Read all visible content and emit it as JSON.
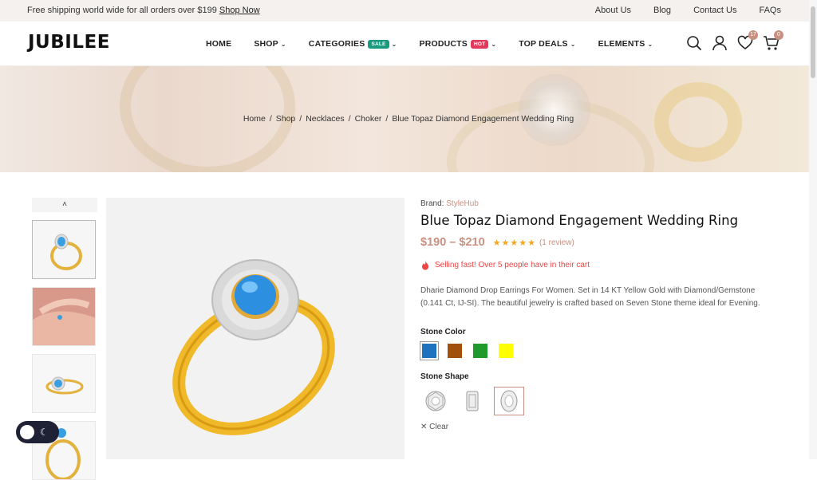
{
  "topbar": {
    "promo_text": "Free shipping world wide for all orders over $199",
    "promo_link": "Shop Now",
    "links": [
      "About Us",
      "Blog",
      "Contact Us",
      "FAQs"
    ]
  },
  "header": {
    "logo": "JUBILEE",
    "nav": [
      {
        "label": "HOME",
        "chevron": false,
        "badge": ""
      },
      {
        "label": "SHOP",
        "chevron": true,
        "badge": ""
      },
      {
        "label": "CATEGORIES",
        "chevron": true,
        "badge": "SALE"
      },
      {
        "label": "PRODUCTS",
        "chevron": true,
        "badge": "HOT"
      },
      {
        "label": "TOP DEALS",
        "chevron": true,
        "badge": ""
      },
      {
        "label": "ELEMENTS",
        "chevron": true,
        "badge": ""
      }
    ],
    "wishlist_count": "17",
    "cart_count": "0",
    "icons": [
      "search-icon",
      "user-icon",
      "heart-icon",
      "cart-icon"
    ]
  },
  "breadcrumb": [
    "Home",
    "Shop",
    "Necklaces",
    "Choker",
    "Blue Topaz Diamond Engagement Wedding Ring"
  ],
  "product": {
    "brand_label": "Brand:",
    "brand_name": "StyleHub",
    "title": "Blue Topaz Diamond Engagement Wedding Ring",
    "price": "$190 – $210",
    "rating": 4.5,
    "stars": "★★★★★",
    "review_text": "(1 review)",
    "selling_fast": "Selling fast! Over 5 people have in their cart",
    "description": "Dharie Diamond Drop Earrings For Women. Set in 14 KT Yellow Gold with Diamond/Gemstone (0.141 Ct, IJ-SI). The beautiful jewelry is crafted based on Seven Stone theme ideal for Evening.",
    "stone_color_label": "Stone Color",
    "stone_colors": [
      "#1e73be",
      "#a0500a",
      "#1f9a2c",
      "#ffff00"
    ],
    "selected_color_index": 0,
    "stone_shape_label": "Stone Shape",
    "stone_shapes": [
      "round",
      "emerald",
      "oval"
    ],
    "selected_shape_index": 2,
    "clear_label": "Clear"
  },
  "theme_toggle": {
    "icon": "moon-icon"
  },
  "colors": {
    "accent": "#c99082",
    "sale": "#1a9a7e",
    "hot": "#e13a5c",
    "toggle_bg": "#1f2235"
  }
}
